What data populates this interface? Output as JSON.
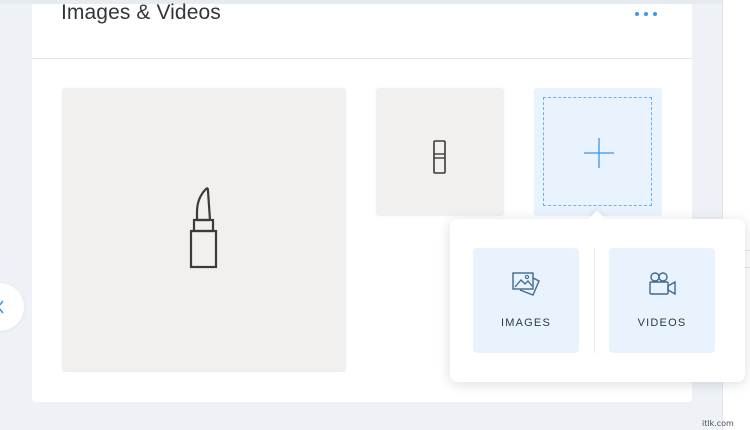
{
  "section": {
    "title": "Images & Videos",
    "more_icon": "more-dots-icon"
  },
  "gallery": {
    "items": [
      {
        "kind": "image",
        "subject": "lipstick-image"
      },
      {
        "kind": "image",
        "subject": "lipstick-tube-image"
      }
    ],
    "add_icon": "plus-icon"
  },
  "popover": {
    "options": [
      {
        "label": "IMAGES",
        "icon": "images-icon"
      },
      {
        "label": "VIDEOS",
        "icon": "video-camera-icon"
      }
    ]
  },
  "nav": {
    "back_icon": "chevron-left-icon"
  },
  "watermark": "itlk.com",
  "colors": {
    "accent": "#3899ec",
    "tile_highlight": "#e8f3fd",
    "thumb_bg": "#f2f0ee",
    "page_bg": "#eef2f6"
  }
}
